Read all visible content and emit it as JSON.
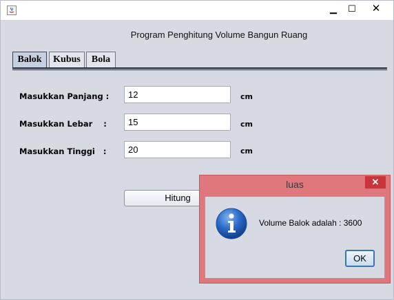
{
  "window": {
    "title": "",
    "minimize_glyph": "▁",
    "maximize_glyph": "☐",
    "close_glyph": "✕"
  },
  "form": {
    "heading": "Program Penghitung Volume Bangun Ruang",
    "tabs": [
      {
        "label": "Balok",
        "active": true
      },
      {
        "label": "Kubus",
        "active": false
      },
      {
        "label": "Bola",
        "active": false
      }
    ],
    "fields": [
      {
        "label": "Masukkan Panjang :",
        "value": "12",
        "unit": "cm"
      },
      {
        "label": "Masukkan Lebar    :",
        "value": "15",
        "unit": "cm"
      },
      {
        "label": "Masukkan Tinggi   :",
        "value": "20",
        "unit": "cm"
      }
    ],
    "calculate_label": "Hitung"
  },
  "dialog": {
    "title": "luas",
    "close_glyph": "✕",
    "message": "Volume Balok adalah : 3600",
    "ok_label": "OK",
    "icon": "info-icon"
  },
  "colors": {
    "background": "#d7dae3",
    "dialog_frame": "#e0777c",
    "dialog_close": "#c8353b",
    "info_icon": "#2a68c8"
  }
}
